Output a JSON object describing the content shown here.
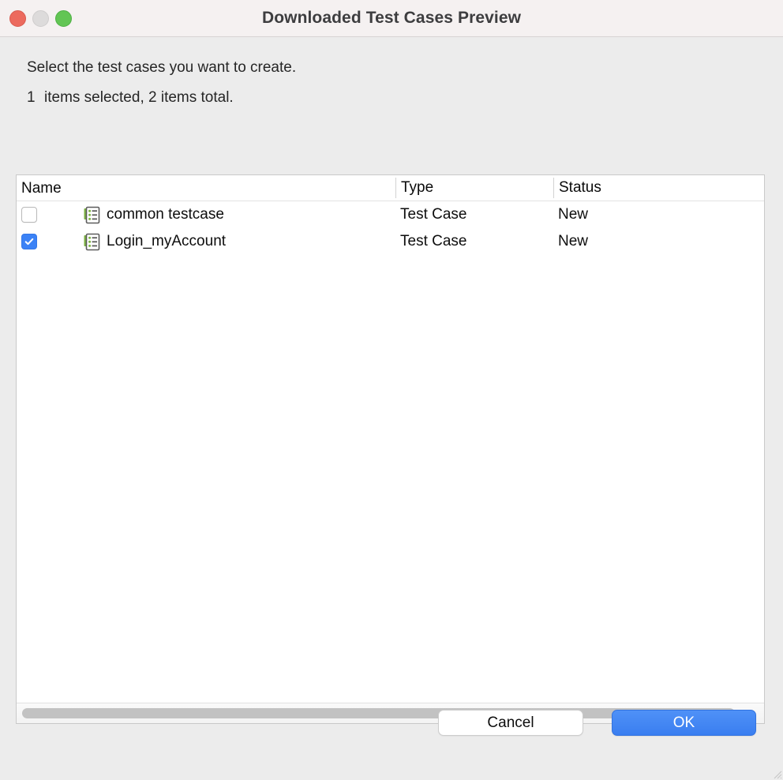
{
  "window": {
    "title": "Downloaded Test Cases Preview",
    "traffic_lights": [
      {
        "name": "close",
        "color": "#ec6a5e"
      },
      {
        "name": "minimize",
        "color": "#dddbdb"
      },
      {
        "name": "maximize",
        "color": "#62c554"
      }
    ]
  },
  "instructions": {
    "line1": "Select the test cases you want to create.",
    "selected_count": "1",
    "count_suffix": "items selected, 2 items total."
  },
  "table": {
    "columns": [
      "Name",
      "Type",
      "Status"
    ],
    "rows": [
      {
        "checked": false,
        "icon": "testcase-document-icon",
        "name": "common testcase",
        "type": "Test Case",
        "status": "New"
      },
      {
        "checked": true,
        "icon": "testcase-document-icon",
        "name": "Login_myAccount",
        "type": "Test Case",
        "status": "New"
      }
    ],
    "scrollbar": {
      "orientation": "horizontal"
    }
  },
  "footer": {
    "cancel_label": "Cancel",
    "ok_label": "OK",
    "ok_accent": "#3a7ef0"
  }
}
